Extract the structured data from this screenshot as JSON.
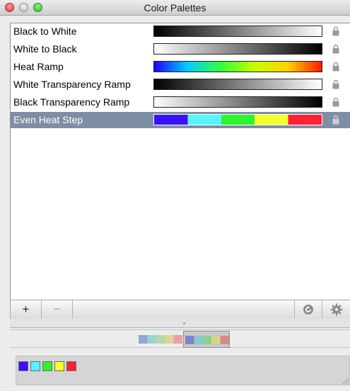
{
  "window": {
    "title": "Color Palettes"
  },
  "palettes": [
    {
      "name": "Black to White",
      "type": "gradient",
      "colors": [
        "#000000",
        "#ffffff"
      ],
      "locked": true,
      "selected": false
    },
    {
      "name": "White to Black",
      "type": "gradient",
      "colors": [
        "#ffffff",
        "#000000"
      ],
      "locked": true,
      "selected": false
    },
    {
      "name": "Heat Ramp",
      "type": "gradient",
      "colors": [
        "#1f00ff",
        "#00cfff",
        "#35ff3a",
        "#c8ff00",
        "#ffd000",
        "#ff1a00"
      ],
      "locked": true,
      "selected": false
    },
    {
      "name": "White Transparency Ramp",
      "type": "gradient",
      "colors": [
        "#000000",
        "#ffffff"
      ],
      "locked": true,
      "selected": false
    },
    {
      "name": "Black Transparency Ramp",
      "type": "gradient",
      "colors": [
        "#ffffff",
        "#000000"
      ],
      "locked": true,
      "selected": false
    },
    {
      "name": "Even Heat Step",
      "type": "step",
      "colors": [
        "#3a10ff",
        "#55f5ff",
        "#2cf52c",
        "#f7ff2a",
        "#ff2035"
      ],
      "locked": true,
      "selected": true
    }
  ],
  "toolbar": {
    "add_label": "+",
    "remove_label": "−",
    "refresh_icon": "refresh-icon",
    "gear_icon": "gear-icon"
  },
  "editor": {
    "thumbnails": [
      {
        "colors": [
          "#8aa8d6",
          "#9ad3d3",
          "#b6d7a8",
          "#e2d39a",
          "#e8a0a0"
        ],
        "selected": false
      },
      {
        "colors": [
          "#7d84c8",
          "#86c9d0",
          "#8fcf8f",
          "#d6d48a",
          "#d88a8a"
        ],
        "selected": true
      }
    ],
    "step_colors": [
      "#3a10ff",
      "#55f5ff",
      "#2cf52c",
      "#f7ff2a",
      "#ff2035"
    ]
  },
  "theme": {
    "selection": "#7e8ea4"
  }
}
